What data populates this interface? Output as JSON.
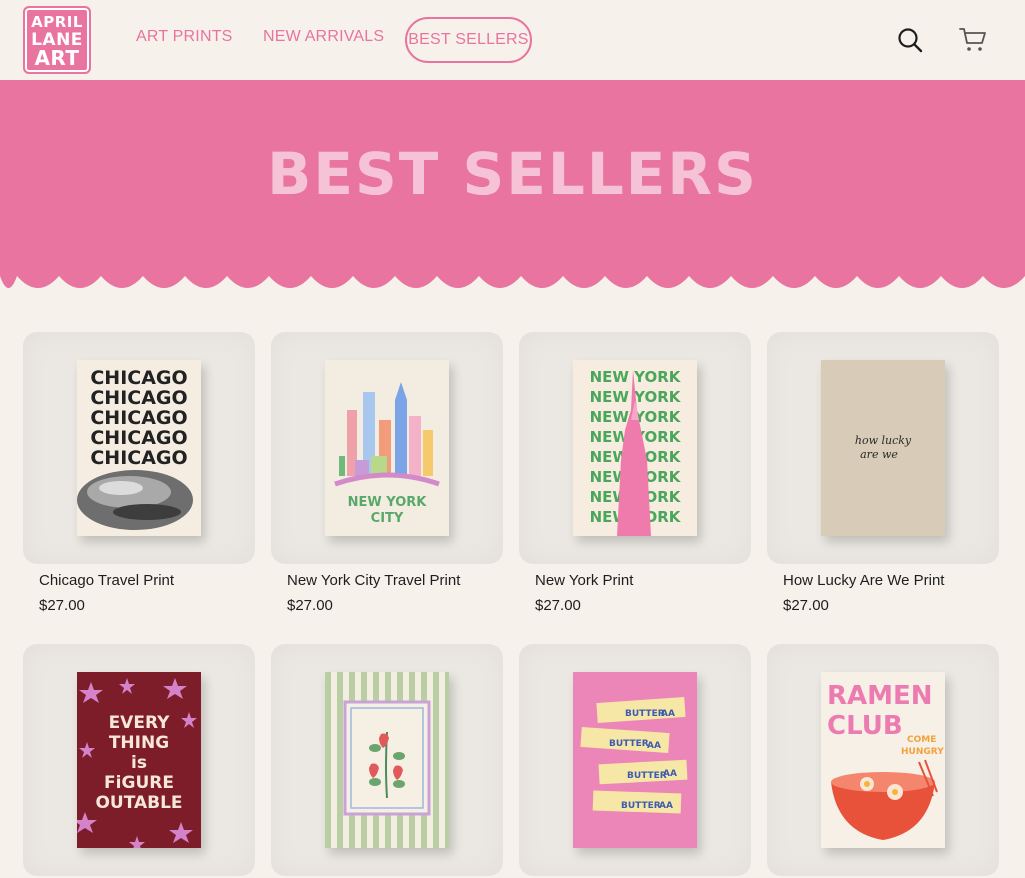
{
  "brand": {
    "logo_lines": [
      "APRIL",
      "LANE",
      "ART"
    ],
    "primary_color": "#e8749f",
    "background_color": "#f6f1eb"
  },
  "nav": {
    "items": [
      {
        "label": "ART PRINTS",
        "active": false
      },
      {
        "label": "NEW ARRIVALS",
        "active": false
      },
      {
        "label": "BEST SELLERS",
        "active": true
      }
    ],
    "search_icon": "search-icon",
    "cart_icon": "cart-icon"
  },
  "hero": {
    "title": "BEST SELLERS"
  },
  "products": [
    {
      "name": "Chicago Travel Print",
      "price": "$27.00",
      "poster_text": [
        "CHICAGO",
        "CHICAGO",
        "CHICAGO",
        "CHICAGO",
        "CHICAGO"
      ]
    },
    {
      "name": "New York City Travel Print",
      "price": "$27.00",
      "poster_text": [
        "NEW YORK",
        "CITY"
      ]
    },
    {
      "name": "New York Print",
      "price": "$27.00",
      "poster_text": [
        "NEW YORK",
        "NEW YORK",
        "NEW YORK",
        "NEW YORK",
        "NEW YORK",
        "NEW YORK",
        "NEW YORK",
        "NEW YORK"
      ]
    },
    {
      "name": "How Lucky Are We Print",
      "price": "$27.00",
      "poster_text": [
        "how lucky",
        "are we"
      ]
    },
    {
      "name": "",
      "price": "",
      "poster_text": [
        "EVERY",
        "THING",
        "is",
        "FiGURE",
        "OUTABLE"
      ]
    },
    {
      "name": "",
      "price": "",
      "poster_text": []
    },
    {
      "name": "",
      "price": "",
      "poster_text": [
        "BUTTER",
        "AA",
        "BUTTER",
        "AA",
        "BUTTER",
        "AA",
        "BUTTER",
        "AA"
      ]
    },
    {
      "name": "",
      "price": "",
      "poster_text": [
        "RAMEN",
        "CLUB",
        "COME",
        "HUNGRY"
      ]
    }
  ]
}
